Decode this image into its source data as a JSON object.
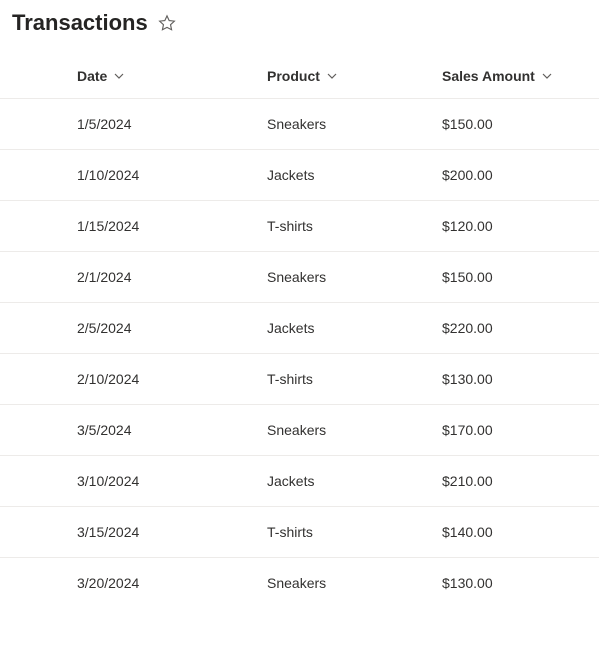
{
  "header": {
    "title": "Transactions"
  },
  "table": {
    "columns": {
      "date": "Date",
      "product": "Product",
      "amount": "Sales Amount"
    },
    "rows": [
      {
        "date": "1/5/2024",
        "product": "Sneakers",
        "amount": "$150.00"
      },
      {
        "date": "1/10/2024",
        "product": "Jackets",
        "amount": "$200.00"
      },
      {
        "date": "1/15/2024",
        "product": "T-shirts",
        "amount": "$120.00"
      },
      {
        "date": "2/1/2024",
        "product": "Sneakers",
        "amount": "$150.00"
      },
      {
        "date": "2/5/2024",
        "product": "Jackets",
        "amount": "$220.00"
      },
      {
        "date": "2/10/2024",
        "product": "T-shirts",
        "amount": "$130.00"
      },
      {
        "date": "3/5/2024",
        "product": "Sneakers",
        "amount": "$170.00"
      },
      {
        "date": "3/10/2024",
        "product": "Jackets",
        "amount": "$210.00"
      },
      {
        "date": "3/15/2024",
        "product": "T-shirts",
        "amount": "$140.00"
      },
      {
        "date": "3/20/2024",
        "product": "Sneakers",
        "amount": "$130.00"
      }
    ]
  }
}
